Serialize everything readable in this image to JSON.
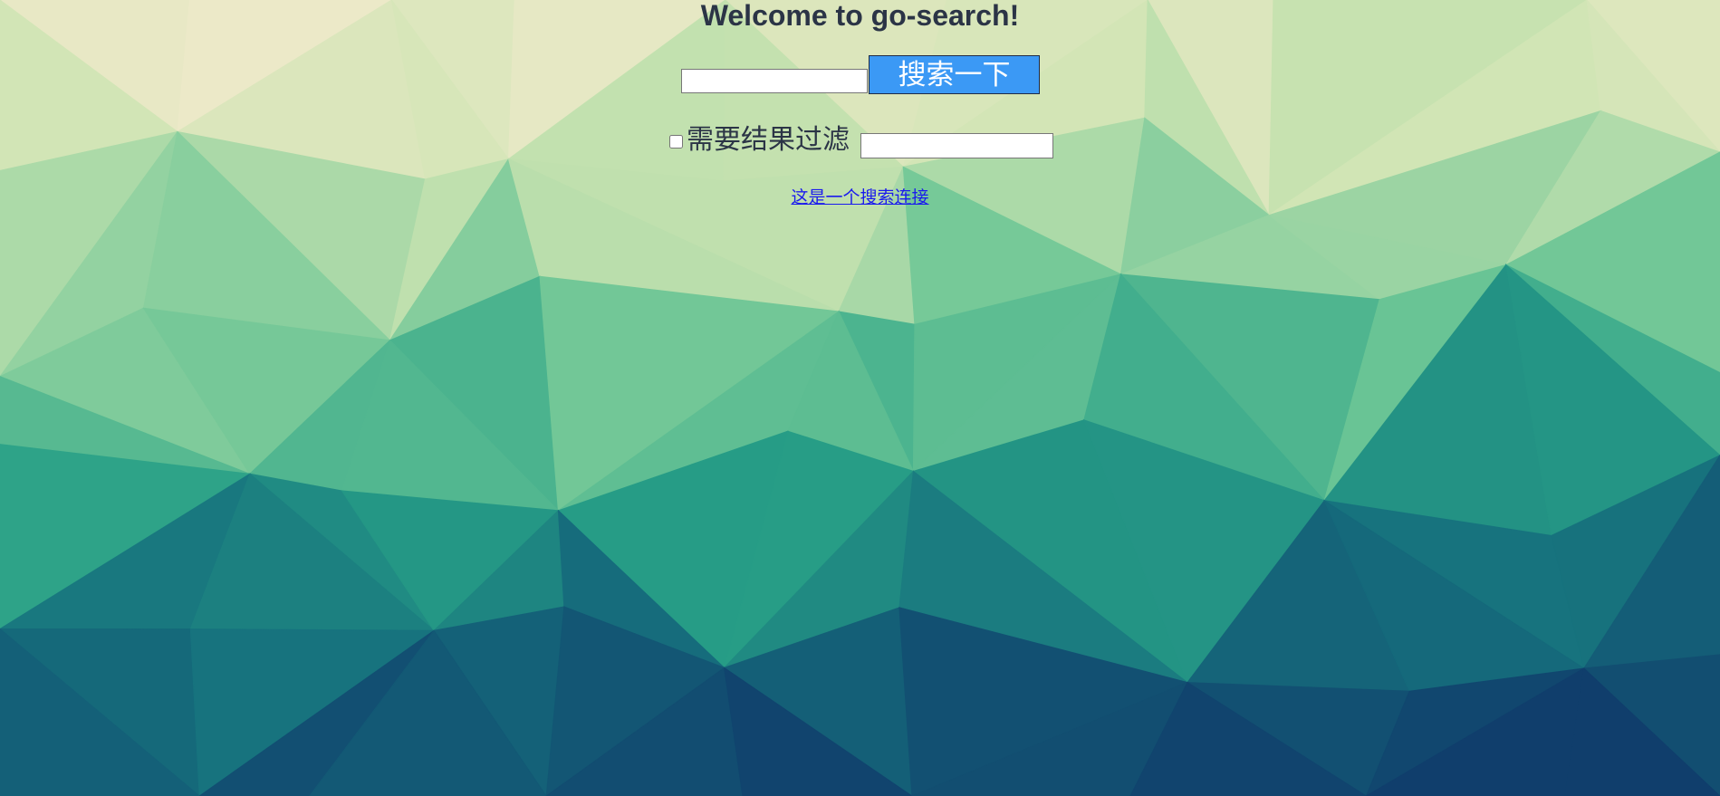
{
  "page": {
    "title": "Welcome to go-search!"
  },
  "search": {
    "query_value": "",
    "button_label": "搜索一下"
  },
  "filter": {
    "checked": false,
    "label": "需要结果过滤",
    "value": ""
  },
  "link": {
    "text": "这是一个搜索连接"
  },
  "colors": {
    "title_text": "#2b3446",
    "button_bg": "#3b99f5",
    "button_text": "#ffffff",
    "link": "#1a1aee",
    "background_light": "#eae8c6",
    "background_mid": "#45b98a",
    "background_dark": "#12426c"
  }
}
